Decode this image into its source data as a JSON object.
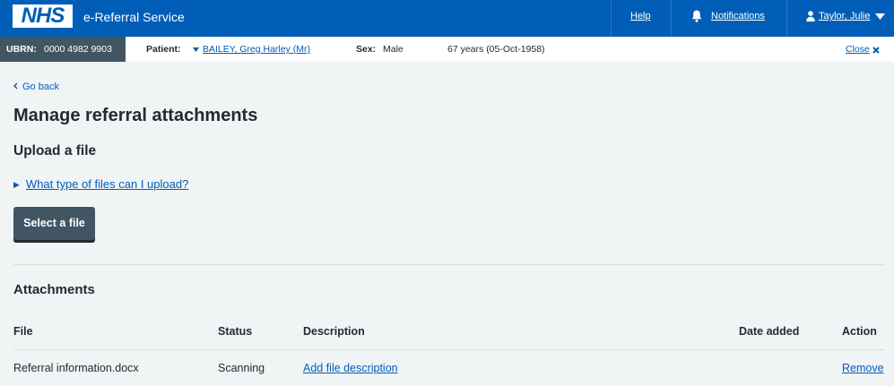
{
  "header": {
    "logo_text": "NHS",
    "service_name": "e-Referral Service",
    "help": "Help",
    "notifications": "Notifications",
    "user": "Taylor, Julie"
  },
  "banner": {
    "ubrn_label": "UBRN:",
    "ubrn_value": "0000 4982 9903",
    "patient_label": "Patient:",
    "patient_name": "BAILEY, Greg Harley (Mr)",
    "sex_label": "Sex:",
    "sex_value": "Male",
    "age_dob": "67 years (05-Oct-1958)",
    "close": "Close"
  },
  "main": {
    "back": "Go back",
    "title": "Manage referral attachments",
    "upload_heading": "Upload a file",
    "details_summary": "What type of files can I upload?",
    "select_file_button": "Select a file",
    "attachments_heading": "Attachments",
    "table": {
      "headers": [
        "File",
        "Status",
        "Description",
        "Date added",
        "Action"
      ],
      "rows": [
        {
          "file": "Referral information.docx",
          "status": "Scanning",
          "description": "Add file description",
          "date_added": "",
          "action": "Remove"
        }
      ]
    }
  },
  "colors": {
    "nhs_blue": "#005eb8",
    "banner_grey": "#425563",
    "background": "#f0f4f5",
    "text": "#212b32"
  },
  "icons": [
    "bell-icon",
    "person-icon",
    "caret-down-icon",
    "close-icon",
    "chevron-left-icon",
    "triangle-right-icon"
  ]
}
